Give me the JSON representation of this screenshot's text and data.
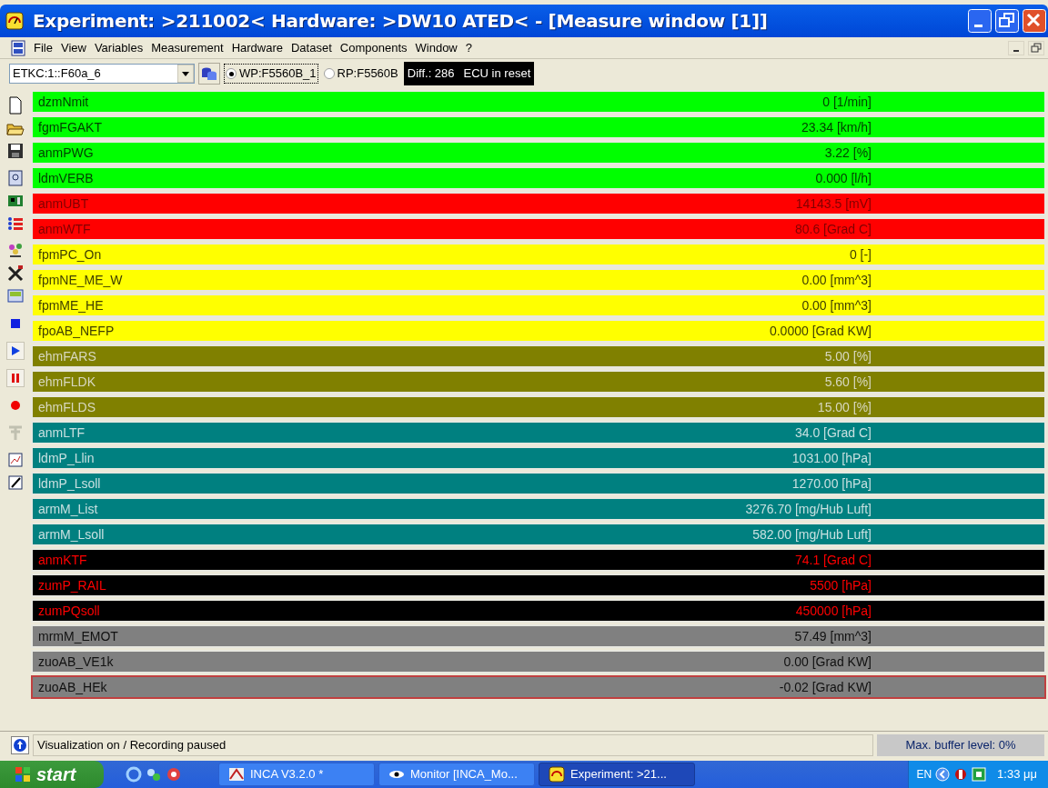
{
  "window": {
    "title": "Experiment: >211002< Hardware: >DW10 ATED< - [Measure window [1]]"
  },
  "menu": [
    "File",
    "View",
    "Variables",
    "Measurement",
    "Hardware",
    "Dataset",
    "Components",
    "Window",
    "?"
  ],
  "toolbar": {
    "device": "ETKC:1::F60a_6",
    "pages": [
      {
        "label": "WP:F5560B_1",
        "selected": true
      },
      {
        "label": "RP:F5560B",
        "selected": false
      }
    ],
    "diff": "Diff.: 286",
    "ecu_status": "ECU in reset"
  },
  "rows": [
    {
      "name": "dzmNmit",
      "value": "0 [1/min]",
      "color": "#00ff00",
      "selected": false
    },
    {
      "name": "fgmFGAKT",
      "value": "23.34 [km/h]",
      "color": "#00ff00",
      "selected": false
    },
    {
      "name": "anmPWG",
      "value": "3.22 [%]",
      "color": "#00ff00",
      "selected": false
    },
    {
      "name": "ldmVERB",
      "value": "0.000 [l/h]",
      "color": "#00ff00",
      "selected": false
    },
    {
      "name": "anmUBT",
      "value": "14143.5 [mV]",
      "color": "#ff0000",
      "selected": false
    },
    {
      "name": "anmWTF",
      "value": "80.6 [Grad C]",
      "color": "#ff0000",
      "selected": false
    },
    {
      "name": "fpmPC_On",
      "value": "0 [-]",
      "color": "#ffff00",
      "selected": false
    },
    {
      "name": "fpmNE_ME_W",
      "value": "0.00 [mm^3]",
      "color": "#ffff00",
      "selected": false
    },
    {
      "name": "fpmME_HE",
      "value": "0.00 [mm^3]",
      "color": "#ffff00",
      "selected": false
    },
    {
      "name": "fpoAB_NEFP",
      "value": "0.0000 [Grad KW]",
      "color": "#ffff00",
      "selected": false
    },
    {
      "name": "ehmFARS",
      "value": "5.00 [%]",
      "color": "#808000",
      "selected": false
    },
    {
      "name": "ehmFLDK",
      "value": "5.60 [%]",
      "color": "#808000",
      "selected": false
    },
    {
      "name": "ehmFLDS",
      "value": "15.00 [%]",
      "color": "#808000",
      "selected": false
    },
    {
      "name": "anmLTF",
      "value": "34.0 [Grad C]",
      "color": "#008080",
      "selected": false
    },
    {
      "name": "ldmP_Llin",
      "value": "1031.00 [hPa]",
      "color": "#008080",
      "selected": false
    },
    {
      "name": "ldmP_Lsoll",
      "value": "1270.00 [hPa]",
      "color": "#008080",
      "selected": false
    },
    {
      "name": "armM_List",
      "value": "3276.70 [mg/Hub Luft]",
      "color": "#008080",
      "selected": false
    },
    {
      "name": "armM_Lsoll",
      "value": "582.00 [mg/Hub Luft]",
      "color": "#008080",
      "selected": false
    },
    {
      "name": "anmKTF",
      "value": "74.1 [Grad C]",
      "color": "#000000",
      "selected": false
    },
    {
      "name": "zumP_RAIL",
      "value": "5500 [hPa]",
      "color": "#000000",
      "selected": false
    },
    {
      "name": "zumPQsoll",
      "value": "450000 [hPa]",
      "color": "#000000",
      "selected": false
    },
    {
      "name": "mrmM_EMOT",
      "value": "57.49 [mm^3]",
      "color": "#808080",
      "selected": false
    },
    {
      "name": "zuoAB_VE1k",
      "value": "0.00 [Grad KW]",
      "color": "#808080",
      "selected": false
    },
    {
      "name": "zuoAB_HEk",
      "value": "-0.02 [Grad KW]",
      "color": "#808080",
      "selected": true
    }
  ],
  "status_bar": {
    "message": "Visualization on / Recording paused",
    "buffer": "Max. buffer level: 0%"
  },
  "taskbar": {
    "start": "start",
    "tasks": [
      {
        "label": "INCA V3.2.0 *",
        "selected": false
      },
      {
        "label": "Monitor [INCA_Mo...",
        "selected": false
      },
      {
        "label": "Experiment: >21...",
        "selected": true
      }
    ],
    "language": "EN",
    "time": "1:33 μμ"
  }
}
